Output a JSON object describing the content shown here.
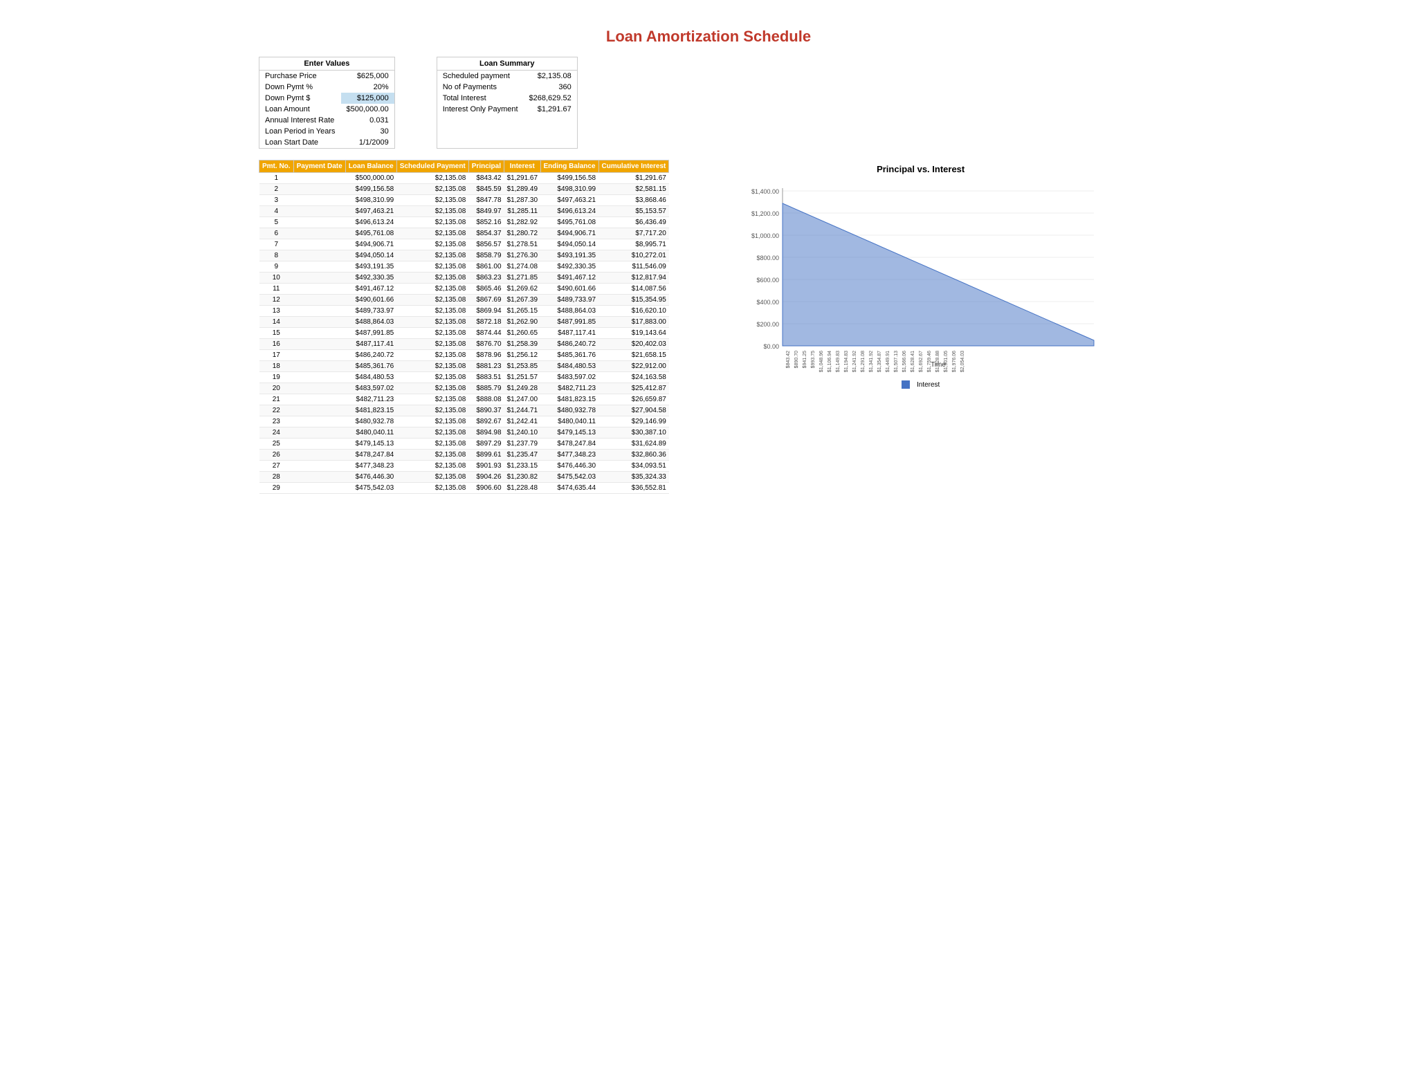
{
  "title": "Loan Amortization Schedule",
  "enter_values": {
    "header": "Enter Values",
    "fields": [
      {
        "label": "Purchase Price",
        "value": "$625,000",
        "highlighted": false
      },
      {
        "label": "Down Pymt %",
        "value": "20%",
        "highlighted": false
      },
      {
        "label": "Down Pymt $",
        "value": "$125,000",
        "highlighted": true
      },
      {
        "label": "Loan Amount",
        "value": "$500,000.00",
        "highlighted": false
      },
      {
        "label": "Annual Interest Rate",
        "value": "0.031",
        "highlighted": false
      },
      {
        "label": "Loan Period in Years",
        "value": "30",
        "highlighted": false
      },
      {
        "label": "Loan Start Date",
        "value": "1/1/2009",
        "highlighted": false
      }
    ]
  },
  "loan_summary": {
    "header": "Loan Summary",
    "fields": [
      {
        "label": "Scheduled payment",
        "value": "$2,135.08"
      },
      {
        "label": "No of Payments",
        "value": "360"
      },
      {
        "label": "Total Interest",
        "value": "$268,629.52"
      },
      {
        "label": "Interest Only Payment",
        "value": "$1,291.67"
      }
    ]
  },
  "table": {
    "headers": [
      "Pmt. No.",
      "Payment Date",
      "Loan Balance",
      "Scheduled Payment",
      "Principal",
      "Interest",
      "Ending Balance",
      "Cumulative Interest"
    ],
    "rows": [
      [
        1,
        "",
        "$500,000.00",
        "$2,135.08",
        "$843.42",
        "$1,291.67",
        "$499,156.58",
        "$1,291.67"
      ],
      [
        2,
        "",
        "$499,156.58",
        "$2,135.08",
        "$845.59",
        "$1,289.49",
        "$498,310.99",
        "$2,581.15"
      ],
      [
        3,
        "",
        "$498,310.99",
        "$2,135.08",
        "$847.78",
        "$1,287.30",
        "$497,463.21",
        "$3,868.46"
      ],
      [
        4,
        "",
        "$497,463.21",
        "$2,135.08",
        "$849.97",
        "$1,285.11",
        "$496,613.24",
        "$5,153.57"
      ],
      [
        5,
        "",
        "$496,613.24",
        "$2,135.08",
        "$852.16",
        "$1,282.92",
        "$495,761.08",
        "$6,436.49"
      ],
      [
        6,
        "",
        "$495,761.08",
        "$2,135.08",
        "$854.37",
        "$1,280.72",
        "$494,906.71",
        "$7,717.20"
      ],
      [
        7,
        "",
        "$494,906.71",
        "$2,135.08",
        "$856.57",
        "$1,278.51",
        "$494,050.14",
        "$8,995.71"
      ],
      [
        8,
        "",
        "$494,050.14",
        "$2,135.08",
        "$858.79",
        "$1,276.30",
        "$493,191.35",
        "$10,272.01"
      ],
      [
        9,
        "",
        "$493,191.35",
        "$2,135.08",
        "$861.00",
        "$1,274.08",
        "$492,330.35",
        "$11,546.09"
      ],
      [
        10,
        "",
        "$492,330.35",
        "$2,135.08",
        "$863.23",
        "$1,271.85",
        "$491,467.12",
        "$12,817.94"
      ],
      [
        11,
        "",
        "$491,467.12",
        "$2,135.08",
        "$865.46",
        "$1,269.62",
        "$490,601.66",
        "$14,087.56"
      ],
      [
        12,
        "",
        "$490,601.66",
        "$2,135.08",
        "$867.69",
        "$1,267.39",
        "$489,733.97",
        "$15,354.95"
      ],
      [
        13,
        "",
        "$489,733.97",
        "$2,135.08",
        "$869.94",
        "$1,265.15",
        "$488,864.03",
        "$16,620.10"
      ],
      [
        14,
        "",
        "$488,864.03",
        "$2,135.08",
        "$872.18",
        "$1,262.90",
        "$487,991.85",
        "$17,883.00"
      ],
      [
        15,
        "",
        "$487,991.85",
        "$2,135.08",
        "$874.44",
        "$1,260.65",
        "$487,117.41",
        "$19,143.64"
      ],
      [
        16,
        "",
        "$487,117.41",
        "$2,135.08",
        "$876.70",
        "$1,258.39",
        "$486,240.72",
        "$20,402.03"
      ],
      [
        17,
        "",
        "$486,240.72",
        "$2,135.08",
        "$878.96",
        "$1,256.12",
        "$485,361.76",
        "$21,658.15"
      ],
      [
        18,
        "",
        "$485,361.76",
        "$2,135.08",
        "$881.23",
        "$1,253.85",
        "$484,480.53",
        "$22,912.00"
      ],
      [
        19,
        "",
        "$484,480.53",
        "$2,135.08",
        "$883.51",
        "$1,251.57",
        "$483,597.02",
        "$24,163.58"
      ],
      [
        20,
        "",
        "$483,597.02",
        "$2,135.08",
        "$885.79",
        "$1,249.28",
        "$482,711.23",
        "$25,412.87"
      ],
      [
        21,
        "",
        "$482,711.23",
        "$2,135.08",
        "$888.08",
        "$1,247.00",
        "$481,823.15",
        "$26,659.87"
      ],
      [
        22,
        "",
        "$481,823.15",
        "$2,135.08",
        "$890.37",
        "$1,244.71",
        "$480,932.78",
        "$27,904.58"
      ],
      [
        23,
        "",
        "$480,932.78",
        "$2,135.08",
        "$892.67",
        "$1,242.41",
        "$480,040.11",
        "$29,146.99"
      ],
      [
        24,
        "",
        "$480,040.11",
        "$2,135.08",
        "$894.98",
        "$1,240.10",
        "$479,145.13",
        "$30,387.10"
      ],
      [
        25,
        "",
        "$479,145.13",
        "$2,135.08",
        "$897.29",
        "$1,237.79",
        "$478,247.84",
        "$31,624.89"
      ],
      [
        26,
        "",
        "$478,247.84",
        "$2,135.08",
        "$899.61",
        "$1,235.47",
        "$477,348.23",
        "$32,860.36"
      ],
      [
        27,
        "",
        "$477,348.23",
        "$2,135.08",
        "$901.93",
        "$1,233.15",
        "$476,446.30",
        "$34,093.51"
      ],
      [
        28,
        "",
        "$476,446.30",
        "$2,135.08",
        "$904.26",
        "$1,230.82",
        "$475,542.03",
        "$35,324.33"
      ],
      [
        29,
        "",
        "$475,542.03",
        "$2,135.08",
        "$906.60",
        "$1,228.48",
        "$474,635.44",
        "$36,552.81"
      ]
    ]
  },
  "chart": {
    "title": "Principal vs. Interest",
    "y_labels": [
      "$1,400.00",
      "$1,200.00",
      "$1,000.00",
      "$800.00",
      "$600.00",
      "$400.00",
      "$200.00",
      "$0.00"
    ],
    "x_label": "Time",
    "legend": [
      {
        "label": "Interest",
        "color": "#4472c4"
      }
    ]
  }
}
